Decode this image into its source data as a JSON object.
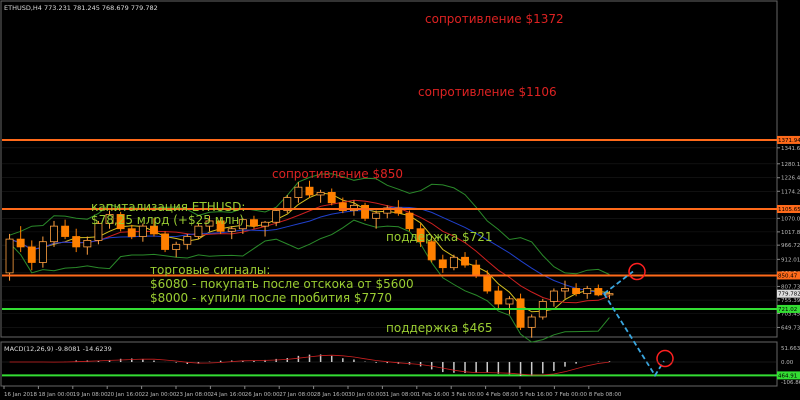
{
  "header": {
    "symbol_info": "ETHUSD,H4  773.231 781.245 768.679 779.782"
  },
  "annotations": {
    "resistance_1372": "сопротивление $1372",
    "resistance_1106": "сопротивление $1106",
    "resistance_850": "сопротивление $850",
    "support_721": "поддержка $721",
    "support_465": "поддержка $465",
    "cap_line1": "капитализация ETHUSD:",
    "cap_line2": "$78,25 млрд (+$25 млн)",
    "signals_title": "торговые сигналы:",
    "signal_1": "$6080 - покупать после отскока от $5600",
    "signal_2": "$8000 - купили после пробития $7770"
  },
  "macd": {
    "label": "MACD(12,26,9) -9.8081 -14.6239"
  },
  "colors": {
    "background": "#000000",
    "resistance_line": "#ff6a1a",
    "support_line": "#33dd33",
    "resistance_text": "#dd2222",
    "support_text": "#9acd32",
    "bull_candle": "#ffa040",
    "bear_candle": "#ff8000",
    "forecast": "#3aa7e0",
    "circle": "#ff2020",
    "axis_text": "#bbbbbb"
  },
  "chart_data": {
    "type": "candlestick",
    "y_axis_ticks": [
      "1341.680",
      "1280.120",
      "1226.430",
      "1174.290",
      "1070.020",
      "1017.870",
      "966.720",
      "912.010",
      "860.340",
      "807.730",
      "755.390",
      "703.450",
      "649.730",
      "597.540",
      "545.490",
      "493.310",
      "441.170",
      "389.030"
    ],
    "price_labels": [
      {
        "text": "1371.94",
        "value": 1372,
        "color": "#ff6a1a"
      },
      {
        "text": "1105.65",
        "value": 1106,
        "color": "#ff6a1a"
      },
      {
        "text": "850.47",
        "value": 850,
        "color": "#ff6a1a"
      },
      {
        "text": "779.782",
        "value": 779.78,
        "color": "#dddddd"
      },
      {
        "text": "721.02",
        "value": 721,
        "color": "#33dd33"
      },
      {
        "text": "464.91",
        "value": 465,
        "color": "#33dd33"
      }
    ],
    "macd_ticks": [
      "51.6639",
      "0.00",
      "-106.8647"
    ],
    "x_axis_labels": [
      "16 Jan 2018",
      "18 Jan 00:00",
      "19 Jan 08:00",
      "20 Jan 16:00",
      "22 Jan 00:00",
      "23 Jan 08:00",
      "24 Jan 16:00",
      "26 Jan 00:00",
      "27 Jan 08:00",
      "28 Jan 16:00",
      "30 Jan 00:00",
      "31 Jan 08:00",
      "1 Feb 16:00",
      "3 Feb 00:00",
      "4 Feb 08:00",
      "5 Feb 16:00",
      "7 Feb 00:00",
      "8 Feb 08:00"
    ],
    "y_range": [
      360,
      1390
    ],
    "levels": [
      1372,
      1106,
      850,
      721,
      465
    ],
    "candles": [
      [
        860,
        1010,
        830,
        990
      ],
      [
        990,
        1040,
        940,
        960
      ],
      [
        960,
        985,
        870,
        900
      ],
      [
        900,
        1000,
        880,
        980
      ],
      [
        980,
        1060,
        960,
        1040
      ],
      [
        1040,
        1065,
        990,
        1000
      ],
      [
        1000,
        1030,
        940,
        960
      ],
      [
        960,
        1000,
        930,
        985
      ],
      [
        985,
        1060,
        970,
        1050
      ],
      [
        1050,
        1100,
        1030,
        1085
      ],
      [
        1085,
        1095,
        1020,
        1030
      ],
      [
        1030,
        1045,
        990,
        1000
      ],
      [
        1000,
        1050,
        980,
        1040
      ],
      [
        1040,
        1070,
        1000,
        1010
      ],
      [
        1010,
        1020,
        940,
        950
      ],
      [
        950,
        980,
        920,
        970
      ],
      [
        970,
        1010,
        950,
        1000
      ],
      [
        1000,
        1050,
        990,
        1040
      ],
      [
        1040,
        1080,
        1020,
        1060
      ],
      [
        1060,
        1075,
        1010,
        1020
      ],
      [
        1020,
        1040,
        990,
        1030
      ],
      [
        1030,
        1070,
        1010,
        1065
      ],
      [
        1065,
        1080,
        1030,
        1040
      ],
      [
        1040,
        1060,
        1000,
        1055
      ],
      [
        1055,
        1110,
        1040,
        1100
      ],
      [
        1100,
        1160,
        1090,
        1150
      ],
      [
        1150,
        1210,
        1130,
        1190
      ],
      [
        1190,
        1215,
        1150,
        1160
      ],
      [
        1160,
        1180,
        1130,
        1170
      ],
      [
        1170,
        1185,
        1120,
        1130
      ],
      [
        1130,
        1150,
        1090,
        1100
      ],
      [
        1100,
        1140,
        1080,
        1120
      ],
      [
        1120,
        1130,
        1060,
        1070
      ],
      [
        1070,
        1100,
        1030,
        1090
      ],
      [
        1090,
        1120,
        1070,
        1110
      ],
      [
        1110,
        1140,
        1080,
        1090
      ],
      [
        1090,
        1100,
        1020,
        1030
      ],
      [
        1030,
        1050,
        960,
        980
      ],
      [
        980,
        990,
        900,
        910
      ],
      [
        910,
        930,
        860,
        880
      ],
      [
        880,
        930,
        870,
        920
      ],
      [
        920,
        940,
        880,
        890
      ],
      [
        890,
        910,
        840,
        850
      ],
      [
        850,
        870,
        780,
        790
      ],
      [
        790,
        810,
        720,
        740
      ],
      [
        740,
        770,
        700,
        760
      ],
      [
        760,
        780,
        640,
        650
      ],
      [
        650,
        700,
        610,
        690
      ],
      [
        690,
        760,
        680,
        750
      ],
      [
        750,
        800,
        730,
        790
      ],
      [
        790,
        830,
        760,
        800
      ],
      [
        800,
        820,
        770,
        780
      ],
      [
        780,
        810,
        760,
        800
      ],
      [
        800,
        815,
        770,
        775
      ],
      [
        775,
        790,
        760,
        780
      ]
    ],
    "forecast": {
      "points": [
        [
          779.78,
          0
        ],
        [
          865,
          1
        ],
        [
          465,
          2
        ],
        [
          520,
          3
        ]
      ],
      "circles": [
        865,
        530
      ]
    }
  }
}
